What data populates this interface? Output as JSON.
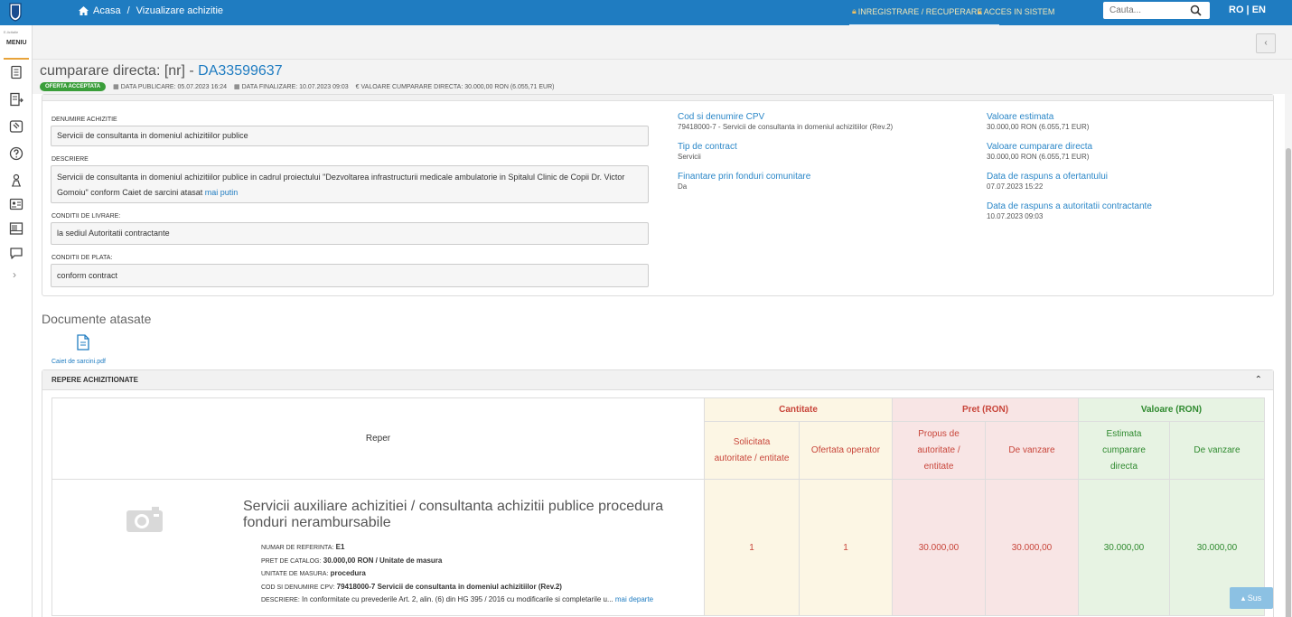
{
  "topbar": {
    "breadcrumb_home": "Acasa",
    "breadcrumb_sep": "/",
    "breadcrumb_current": "Vizualizare achizitie",
    "register_label": "INREGISTRARE / RECUPERARE",
    "login_label": "ACCES IN SISTEM",
    "search_placeholder": "Cauta...",
    "lang": "RO | EN"
  },
  "sidebar": {
    "small_label": "E-licitatie",
    "menu_label": "MENIU",
    "icons": [
      "document-icon",
      "list-icon",
      "gavel-icon",
      "help-icon",
      "auction-icon",
      "id-card-icon",
      "catalog-icon",
      "chat-icon"
    ]
  },
  "header": {
    "title_prefix": "cumparare directa: [nr] - ",
    "code": "DA33599637",
    "status_badge": "OFERTA ACCEPTATA",
    "data_publicare": "DATA PUBLICARE: 05.07.2023 16:24",
    "data_finalizare": "DATA FINALIZARE: 10.07.2023 09:03",
    "valoare": "€ VALOARE CUMPARARE DIRECTA: 30.000,00  RON (6.055,71  EUR)"
  },
  "details": {
    "denumire_label": "DENUMIRE ACHIZITIE",
    "denumire_value": "Servicii de consultanta in domeniul achizitiilor publice",
    "descriere_label": "DESCRIERE",
    "descriere_value": "Servicii de consultanta in domeniul achizitiilor publice in cadrul proiectului \"Dezvoltarea infrastructurii medicale ambulatorie in Spitalul Clinic de Copii Dr. Victor Gomoiu\" conform Caiet de sarcini atasat ",
    "descriere_link": "mai putin",
    "livrare_label": "CONDITII DE LIVRARE:",
    "livrare_value": "la sediul Autoritatii contractante",
    "plata_label": "CONDITII DE PLATA:",
    "plata_value": "conform contract"
  },
  "info": {
    "cpv_label": "Cod si denumire CPV",
    "cpv_value": "79418000-7 - Servicii de consultanta in domeniul achizitiilor (Rev.2)",
    "tip_label": "Tip de contract",
    "tip_value": "Servicii",
    "fin_label": "Finantare prin fonduri comunitare",
    "fin_value": "Da",
    "val_est_label": "Valoare estimata",
    "val_est_value": "30.000,00  RON (6.055,71  EUR)",
    "val_cd_label": "Valoare cumparare directa",
    "val_cd_value": "30.000,00  RON (6.055,71  EUR)",
    "resp_of_label": "Data de raspuns a ofertantului",
    "resp_of_value": "07.07.2023 15:22",
    "resp_ac_label": "Data de raspuns a autoritatii contractante",
    "resp_ac_value": "10.07.2023 09:03"
  },
  "documents": {
    "title": "Documente atasate",
    "files": [
      "Caiet de sarcini.pdf"
    ]
  },
  "repere": {
    "title": "REPERE ACHIZITIONATE",
    "col_reper": "Reper",
    "grp_cantitate": "Cantitate",
    "grp_pret": "Pret (RON)",
    "grp_valoare": "Valoare (RON)",
    "sub_solicitata": "Solicitata autoritate / entitate",
    "sub_ofertata": "Ofertata operator",
    "sub_propus": "Propus de autoritate / entitate",
    "sub_vanzare": "De vanzare",
    "sub_estimata": "Estimata cumparare directa",
    "sub_vanzare2": "De vanzare",
    "item": {
      "title": "Servicii auxiliare achizitiei / consultanta achizitii publice procedura fonduri nerambursabile",
      "ref_label": "NUMAR DE REFERINTA:",
      "ref_value": "E1",
      "pret_label": "PRET DE CATALOG:",
      "pret_value": "30.000,00  RON / Unitate de masura",
      "um_label": "UNITATE DE MASURA:",
      "um_value": "procedura",
      "cpv_label": "COD SI DENUMIRE CPV:",
      "cpv_value": "79418000-7 Servicii de consultanta in domeniul achizitiilor (Rev.2)",
      "desc_label": "DESCRIERE:",
      "desc_value": "In conformitate cu prevederile Art. 2, alin. (6) din HG 395 / 2016 cu modificarile si completarile u...",
      "desc_link": "mai departe",
      "solicitata": "1",
      "ofertata": "1",
      "propus": "30.000,00",
      "vanzare": "30.000,00",
      "estimata": "30.000,00",
      "vanzare2": "30.000,00"
    }
  },
  "scroll_top": "Sus"
}
